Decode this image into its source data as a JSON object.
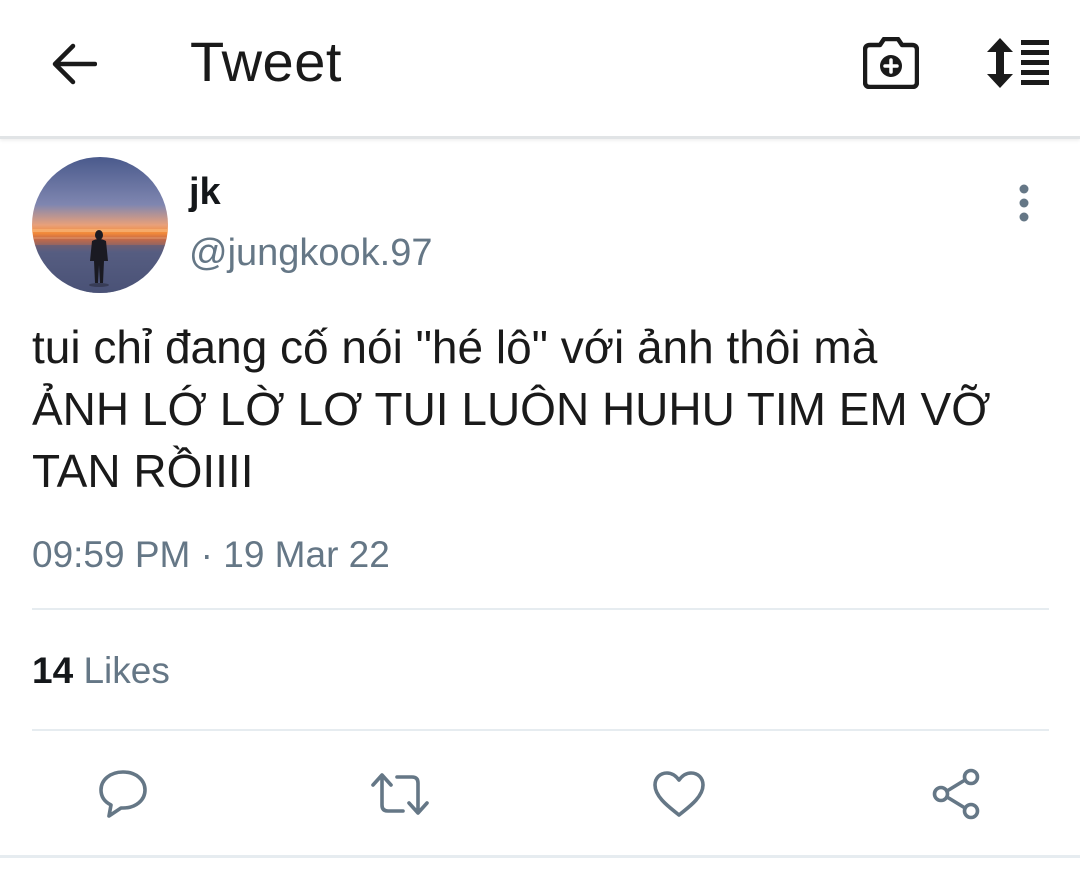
{
  "header": {
    "title": "Tweet",
    "back_icon": "arrow-left-icon",
    "camera_icon": "camera-plus-icon",
    "sort_icon": "sort-list-icon"
  },
  "tweet": {
    "author_name": "jk",
    "author_handle": "@jungkook.97",
    "text": "tui chỉ đang cố nói \"hé lô\" với ảnh thôi mà\nẢNH LỚ LỜ LƠ TUI LUÔN HUHU TIM EM VỠ\nTAN RỒIIII",
    "timestamp": "09:59 PM · 19 Mar 22",
    "likes_count": "14",
    "likes_label": "Likes"
  },
  "actions": [
    {
      "name": "reply",
      "icon": "reply-icon"
    },
    {
      "name": "retweet",
      "icon": "retweet-icon"
    },
    {
      "name": "like",
      "icon": "heart-icon"
    },
    {
      "name": "share",
      "icon": "share-icon"
    }
  ],
  "colors": {
    "text_primary": "#14171a",
    "text_secondary": "#657786",
    "icon_gray": "#657786",
    "divider": "#e6ecf0"
  }
}
